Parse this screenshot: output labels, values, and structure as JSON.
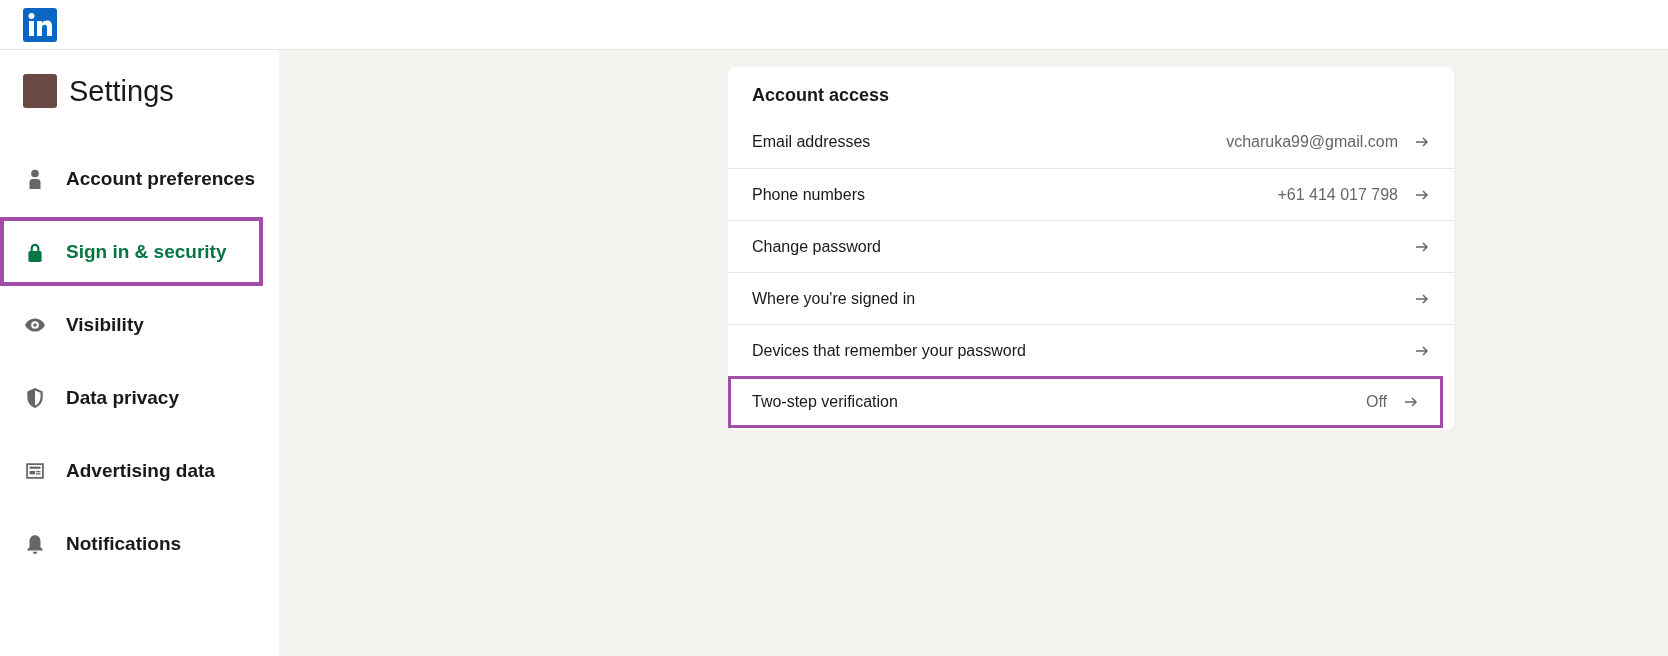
{
  "sidebar": {
    "title": "Settings",
    "items": [
      {
        "label": "Account preferences",
        "selected": false,
        "highlighted": false
      },
      {
        "label": "Sign in & security",
        "selected": true,
        "highlighted": true
      },
      {
        "label": "Visibility",
        "selected": false,
        "highlighted": false
      },
      {
        "label": "Data privacy",
        "selected": false,
        "highlighted": false
      },
      {
        "label": "Advertising data",
        "selected": false,
        "highlighted": false
      },
      {
        "label": "Notifications",
        "selected": false,
        "highlighted": false
      }
    ]
  },
  "card": {
    "title": "Account access",
    "rows": [
      {
        "label": "Email addresses",
        "value": "vcharuka99@gmail.com",
        "highlighted": false
      },
      {
        "label": "Phone numbers",
        "value": "+61 414 017 798",
        "highlighted": false
      },
      {
        "label": "Change password",
        "highlighted": false
      },
      {
        "label": "Where you're signed in",
        "highlighted": false
      },
      {
        "label": "Devices that remember your password",
        "highlighted": false
      },
      {
        "label": "Two-step verification",
        "value": "Off",
        "highlighted": true
      }
    ]
  }
}
